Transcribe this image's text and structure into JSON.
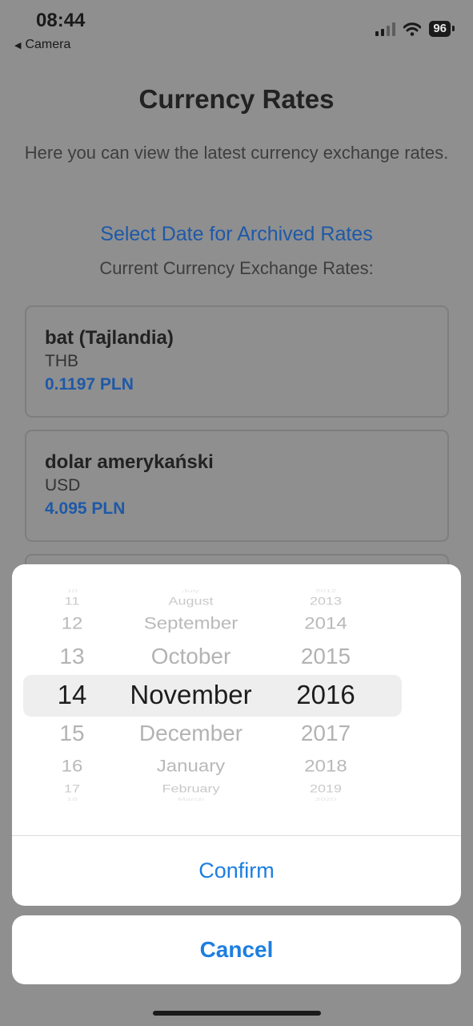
{
  "status_bar": {
    "time": "08:44",
    "back_app": "Camera",
    "battery": "96",
    "icons": [
      "signal-icon",
      "wifi-icon",
      "battery-icon"
    ]
  },
  "page": {
    "title": "Currency Rates",
    "description": "Here you can view the latest currency exchange rates.",
    "select_date_link": "Select Date for Archived Rates",
    "current_label": "Current Currency Exchange Rates:"
  },
  "rates": [
    {
      "name": "bat (Tajlandia)",
      "code": "THB",
      "rate": "0.1197 PLN"
    },
    {
      "name": "dolar amerykański",
      "code": "USD",
      "rate": "4.095 PLN"
    }
  ],
  "picker": {
    "days": [
      "10",
      "11",
      "12",
      "13",
      "14",
      "15",
      "16",
      "17",
      "18"
    ],
    "months": [
      "July",
      "August",
      "September",
      "October",
      "November",
      "December",
      "January",
      "February",
      "March"
    ],
    "years": [
      "2012",
      "2013",
      "2014",
      "2015",
      "2016",
      "2017",
      "2018",
      "2019",
      "2020"
    ],
    "selected": {
      "day": "14",
      "month": "November",
      "year": "2016"
    }
  },
  "actions": {
    "confirm": "Confirm",
    "cancel": "Cancel"
  },
  "colors": {
    "accent": "#1d7ee0",
    "link": "#1e59a8",
    "overlay_background": "#8f8f8f"
  }
}
